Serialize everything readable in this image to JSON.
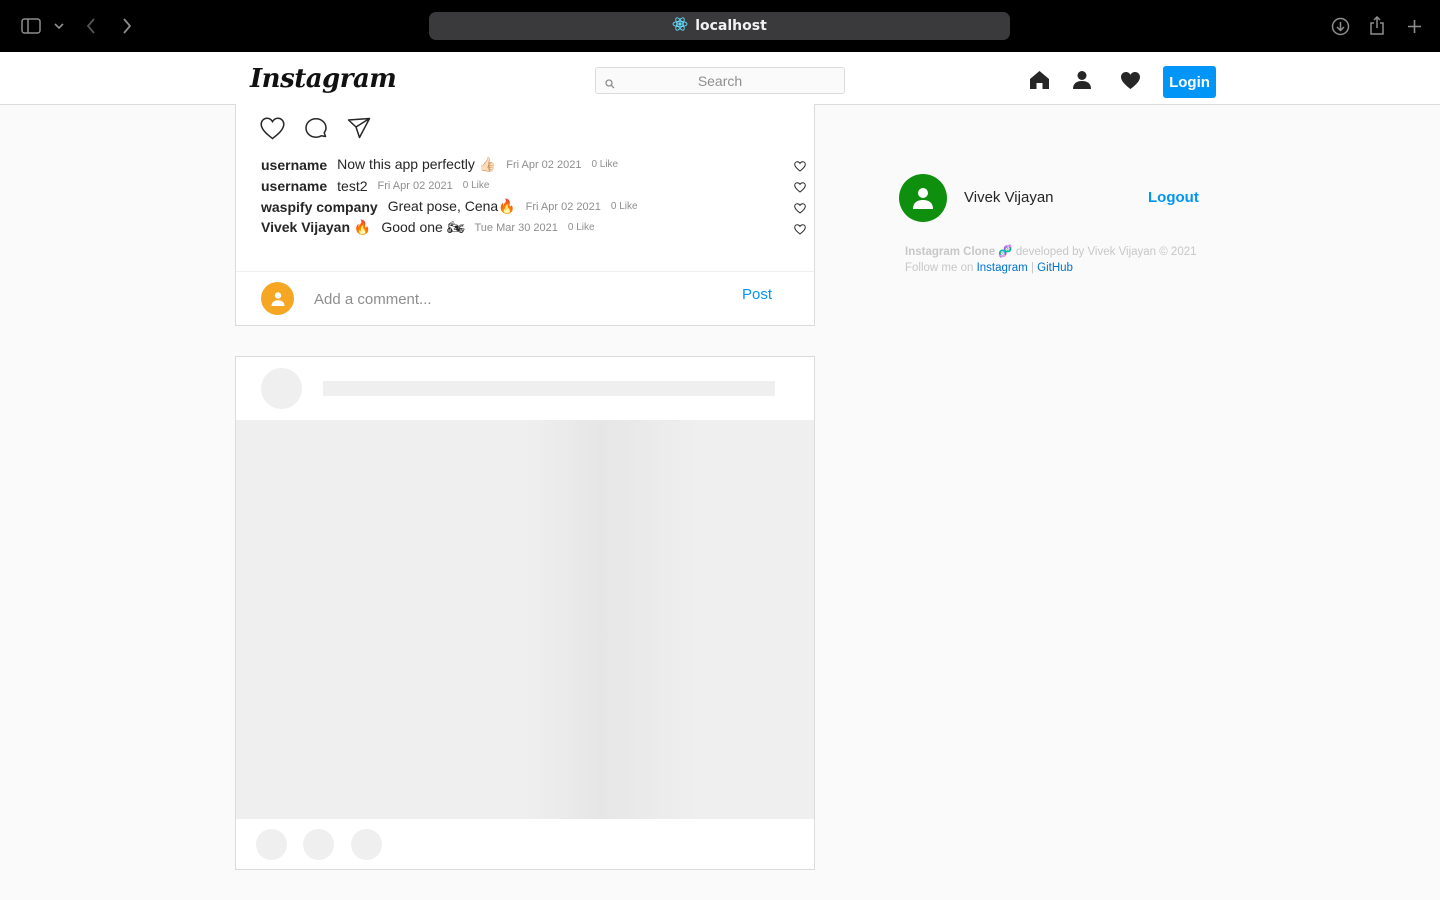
{
  "browser": {
    "url": "localhost"
  },
  "header": {
    "logo": "Instagram",
    "search_placeholder": "Search",
    "login_label": "Login"
  },
  "post": {
    "comments": [
      {
        "user": "username",
        "text": "Now this app perfectly 👍🏻",
        "date": "Fri Apr 02 2021",
        "likes": "0 Like"
      },
      {
        "user": "username",
        "text": "test2",
        "date": "Fri Apr 02 2021",
        "likes": "0 Like"
      },
      {
        "user": "waspify company",
        "text": "Great pose, Cena🔥",
        "date": "Fri Apr 02 2021",
        "likes": "0 Like"
      },
      {
        "user": "Vivek Vijayan 🔥",
        "text": "Good one 🏍",
        "date": "Tue Mar 30 2021",
        "likes": "0 Like"
      }
    ],
    "comment_placeholder": "Add a comment...",
    "post_label": "Post"
  },
  "sidebar": {
    "name": "Vivek Vijayan",
    "logout_label": "Logout",
    "footer": {
      "app_name": "Instagram Clone",
      "emoji": "🧬",
      "developed_by": "developed by Vivek Vijayan © 2021",
      "follow_prefix": "Follow me on",
      "instagram_link": "Instagram",
      "separator": "|",
      "github_link": "GitHub"
    }
  },
  "colors": {
    "accent": "#0095f6",
    "avatar_green": "#0e8f0e",
    "avatar_orange": "#f5a623"
  }
}
